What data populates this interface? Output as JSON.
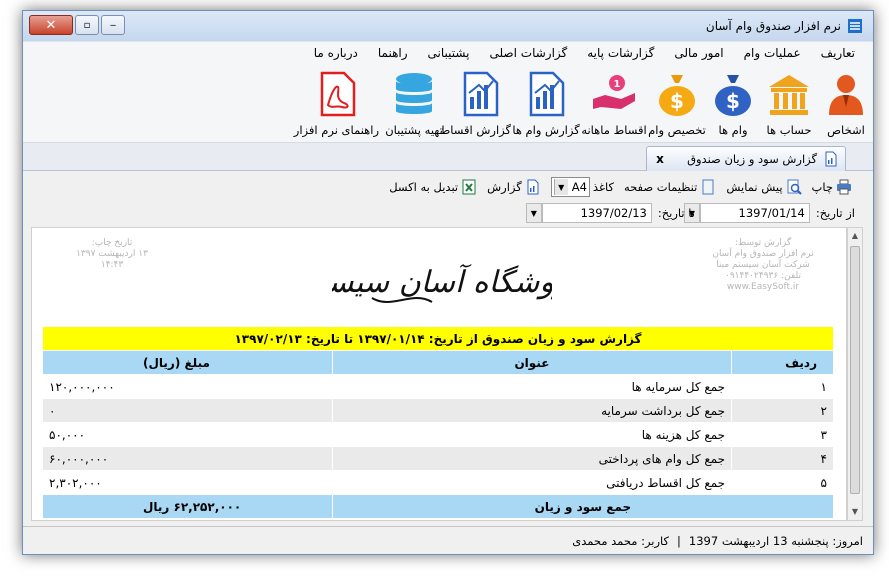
{
  "window": {
    "title": "نرم افزار صندوق وام آسان"
  },
  "menu": [
    "تعاریف",
    "عملیات وام",
    "امور مالی",
    "گزارشات پایه",
    "گزارشات اصلی",
    "پشتیبانی",
    "راهنما",
    "درباره ما"
  ],
  "toolbar": [
    {
      "label": "اشخاص",
      "icon": "person-icon"
    },
    {
      "label": "حساب ها",
      "icon": "bank-icon"
    },
    {
      "label": "وام ها",
      "icon": "money-bag-icon"
    },
    {
      "label": "تخصیص وام",
      "icon": "coin-bag-icon"
    },
    {
      "label": "اقساط ماهانه",
      "icon": "hand-coin-icon"
    },
    {
      "label": "گزارش وام ها",
      "icon": "report-chart-icon"
    },
    {
      "label": "گزارش اقساط",
      "icon": "report-chart-icon"
    },
    {
      "label": "تهیه پشتیبان",
      "icon": "database-icon"
    },
    {
      "label": "راهنمای نرم افزار",
      "icon": "pdf-icon"
    }
  ],
  "tab": {
    "label": "گزارش سود و زیان صندوق",
    "close": "x"
  },
  "report_toolbar": {
    "print": "چاپ",
    "preview": "پیش نمایش",
    "page_settings": "تنظیمات صفحه",
    "paper_label": "کاغذ",
    "paper_value": "A4",
    "report": "گزارش",
    "excel": "تبدیل به اکسل"
  },
  "dates": {
    "from_label": "از تاریخ:",
    "from_value": "1397/01/14",
    "to_label": "تا تاریخ:",
    "to_value": "1397/02/13"
  },
  "stamp_right": [
    "گزارش توسط:",
    "نرم افزار صندوق وام آسان",
    "شرکت آسان سیستم مبنا",
    "تلفن: ۰۹۱۴۴۰۲۴۹۳۶",
    "www.EasySoft.ir"
  ],
  "stamp_left": [
    "تاریخ چاپ:",
    "۱۳ اردیبهشت ۱۳۹۷",
    "۱۴:۴۳"
  ],
  "store_name": "فروشگاه آسان سیستم",
  "report": {
    "title": "گزارش سود و زیان صندوق از تاریخ: ۱۳۹۷/۰۱/۱۴ تا تاریخ: ۱۳۹۷/۰۲/۱۳",
    "headers": {
      "row": "ردیف",
      "title": "عنوان",
      "amount": "مبلغ (ریال)"
    },
    "rows": [
      {
        "n": "۱",
        "title": "جمع کل سرمایه ها",
        "amount": "۱۲۰,۰۰۰,۰۰۰"
      },
      {
        "n": "۲",
        "title": "جمع کل برداشت سرمایه",
        "amount": "۰"
      },
      {
        "n": "۳",
        "title": "جمع کل هزینه ها",
        "amount": "۵۰,۰۰۰"
      },
      {
        "n": "۴",
        "title": "جمع کل وام های پرداختی",
        "amount": "۶۰,۰۰۰,۰۰۰"
      },
      {
        "n": "۵",
        "title": "جمع کل اقساط دریافتی",
        "amount": "۲,۳۰۲,۰۰۰"
      }
    ],
    "footer": {
      "label": "جمع سود و زیان",
      "amount": "۶۲,۲۵۲,۰۰۰ ریال"
    }
  },
  "status": {
    "today": "امروز: پنجشنبه 13 اردیبهشت 1397",
    "sep": "|",
    "user": "کاربر: محمد محمدی"
  },
  "colors": {
    "title_bg": "#ffff00",
    "header_bg": "#a9d8f5",
    "accent": "#1e6fc7"
  }
}
